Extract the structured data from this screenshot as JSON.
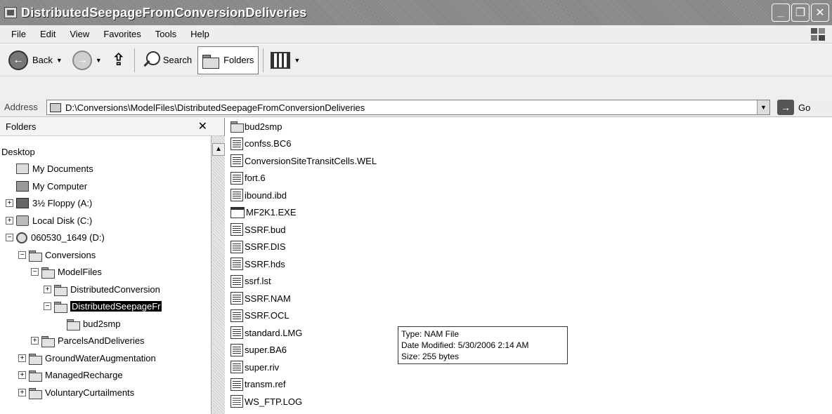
{
  "window": {
    "title": "DistributedSeepageFromConversionDeliveries",
    "minimize": "_",
    "maximize": "❐",
    "close": "✕"
  },
  "menu": [
    "File",
    "Edit",
    "View",
    "Favorites",
    "Tools",
    "Help"
  ],
  "toolbar": {
    "back_label": "Back",
    "search_label": "Search",
    "folders_label": "Folders"
  },
  "address": {
    "label": "Address",
    "path": "D:\\Conversions\\ModelFiles\\DistributedSeepageFromConversionDeliveries",
    "go_label": "Go"
  },
  "folders_pane": {
    "header": "Folders",
    "tree": [
      {
        "label": "Desktop",
        "icon": "desktop-icon",
        "expander": ""
      },
      {
        "label": "My Documents",
        "icon": "my-documents-icon",
        "expander": ""
      },
      {
        "label": "My Computer",
        "icon": "my-computer-icon",
        "expander": ""
      },
      {
        "label": "3½ Floppy (A:)",
        "icon": "floppy-icon",
        "expander": "+"
      },
      {
        "label": "Local Disk (C:)",
        "icon": "hard-drive-icon",
        "expander": "+"
      },
      {
        "label": "060530_1649 (D:)",
        "icon": "cd-drive-icon",
        "expander": "−"
      },
      {
        "label": "Conversions",
        "icon": "folder-icon",
        "expander": "−"
      },
      {
        "label": "ModelFiles",
        "icon": "folder-icon",
        "expander": "−"
      },
      {
        "label": "DistributedConversion",
        "icon": "folder-icon",
        "expander": "+"
      },
      {
        "label": "DistributedSeepageFr",
        "icon": "folder-open-icon",
        "expander": "−",
        "selected": true
      },
      {
        "label": "bud2smp",
        "icon": "folder-icon",
        "expander": ""
      },
      {
        "label": "ParcelsAndDeliveries",
        "icon": "folder-icon",
        "expander": "+"
      },
      {
        "label": "GroundWaterAugmentation",
        "icon": "folder-icon",
        "expander": "+"
      },
      {
        "label": "ManagedRecharge",
        "icon": "folder-icon",
        "expander": "+"
      },
      {
        "label": "VoluntaryCurtailments",
        "icon": "folder-icon",
        "expander": "+"
      }
    ]
  },
  "files": [
    {
      "name": "bud2smp",
      "icon": "folder-icon"
    },
    {
      "name": "confss.BC6",
      "icon": "file-icon"
    },
    {
      "name": "ConversionSiteTransitCells.WEL",
      "icon": "file-icon"
    },
    {
      "name": "fort.6",
      "icon": "file-icon"
    },
    {
      "name": "ibound.ibd",
      "icon": "file-icon"
    },
    {
      "name": "MF2K1.EXE",
      "icon": "exe-icon"
    },
    {
      "name": "SSRF.bud",
      "icon": "file-icon"
    },
    {
      "name": "SSRF.DIS",
      "icon": "file-icon"
    },
    {
      "name": "SSRF.hds",
      "icon": "file-icon"
    },
    {
      "name": "ssrf.lst",
      "icon": "file-icon"
    },
    {
      "name": "SSRF.NAM",
      "icon": "file-icon"
    },
    {
      "name": "SSRF.OCL",
      "icon": "file-icon"
    },
    {
      "name": "standard.LMG",
      "icon": "file-icon"
    },
    {
      "name": "super.BA6",
      "icon": "file-icon"
    },
    {
      "name": "super.riv",
      "icon": "file-icon"
    },
    {
      "name": "transm.ref",
      "icon": "file-icon"
    },
    {
      "name": "WS_FTP.LOG",
      "icon": "log-icon"
    }
  ],
  "tooltip": {
    "type": "Type: NAM File",
    "modified": "Date Modified: 5/30/2006 2:14 AM",
    "size": "Size: 255 bytes"
  }
}
